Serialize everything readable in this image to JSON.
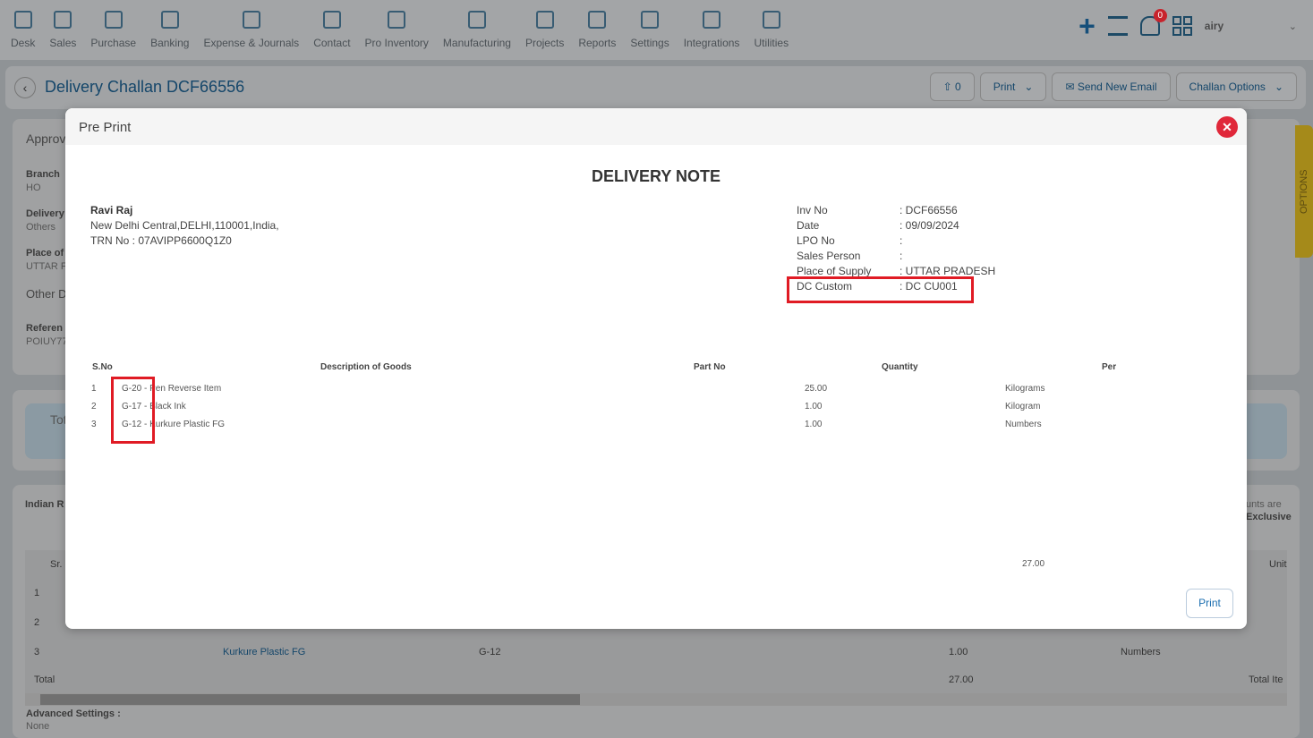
{
  "nav": {
    "items": [
      "Desk",
      "Sales",
      "Purchase",
      "Banking",
      "Expense & Journals",
      "Contact",
      "Pro Inventory",
      "Manufacturing",
      "Projects",
      "Reports",
      "Settings",
      "Integrations",
      "Utilities"
    ],
    "notifications": "0",
    "user": "airy"
  },
  "header": {
    "title": "Delivery Challan DCF66556",
    "attach_count": "0",
    "print": "Print",
    "send_email": "Send New Email",
    "challan_options": "Challan Options"
  },
  "background": {
    "approval": "Approv",
    "branch_label": "Branch",
    "branch": "HO",
    "delivery_label": "Delivery",
    "delivery": "Others",
    "place_label": "Place of",
    "place": "UTTAR F",
    "other": "Other D",
    "reference_label": "Referen",
    "reference": "POIUY77",
    "total": "Tot",
    "currency": "Indian R",
    "amounts_note_1": "unts are",
    "amounts_note_2": "Exclusive",
    "col_sr": "Sr.",
    "col_unit": "Unit",
    "rows": [
      {
        "sr": "1"
      },
      {
        "sr": "2"
      },
      {
        "sr": "3",
        "item": "Kurkure Plastic FG",
        "code": "G-12",
        "qty": "1.00",
        "unit": "Numbers"
      }
    ],
    "total_label": "Total",
    "total_qty": "27.00",
    "total_items": "Total Ite",
    "advanced_label": "Advanced Settings :",
    "advanced_value": "None",
    "options_tab": "OPTIONS"
  },
  "modal": {
    "title": "Pre Print",
    "print": "Print",
    "doc": {
      "title": "DELIVERY NOTE",
      "customer": "Ravi Raj",
      "address": "New Delhi Central,DELHI,110001,India,",
      "trn": "TRN No : 07AVIPP6600Q1Z0",
      "meta": [
        {
          "label": "Inv No",
          "value": ": DCF66556"
        },
        {
          "label": "Date",
          "value": ": 09/09/2024"
        },
        {
          "label": "LPO No",
          "value": ":"
        },
        {
          "label": "Sales Person",
          "value": ":"
        },
        {
          "label": "Place of Supply",
          "value": ": UTTAR PRADESH"
        },
        {
          "label": "DC Custom",
          "value": ": DC CU001"
        }
      ],
      "columns": [
        "S.No",
        "Description of Goods",
        "Part No",
        "Quantity",
        "Per"
      ],
      "items": [
        {
          "sno": "1",
          "desc": "G-20 - Pen Reverse Item",
          "qty": "25.00",
          "per": "Kilograms"
        },
        {
          "sno": "2",
          "desc": "G-17 - Black Ink",
          "qty": "1.00",
          "per": "Kilogram"
        },
        {
          "sno": "3",
          "desc": "G-12 - Kurkure Plastic FG",
          "qty": "1.00",
          "per": "Numbers"
        }
      ],
      "total_qty": "27.00"
    }
  }
}
